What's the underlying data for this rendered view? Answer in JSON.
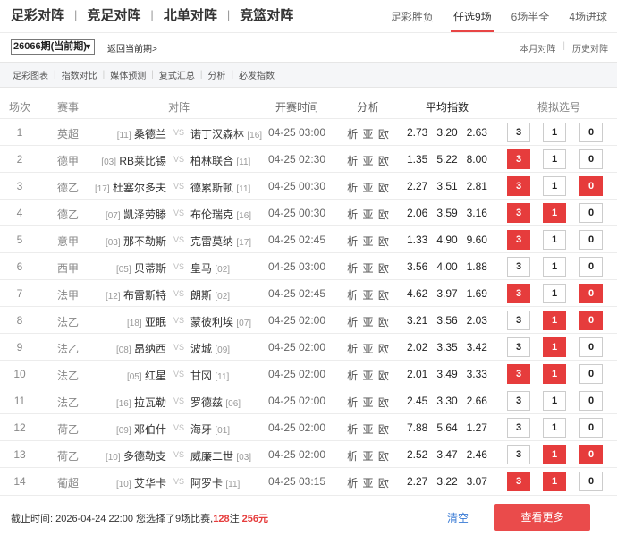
{
  "nav": {
    "items": [
      "足彩对阵",
      "竞足对阵",
      "北单对阵",
      "竞篮对阵"
    ],
    "separator": "|"
  },
  "tabs": [
    {
      "label": "足彩胜负",
      "active": false
    },
    {
      "label": "任选9场",
      "active": true
    },
    {
      "label": "6场半全",
      "active": false
    },
    {
      "label": "4场进球",
      "active": false
    }
  ],
  "issue": {
    "selected": "26066期(当前期)",
    "back_link": "返回当前期>",
    "right_links": [
      "本月对阵",
      "历史对阵"
    ]
  },
  "tools": [
    "足彩图表",
    "指数对比",
    "媒体预测",
    "复式汇总",
    "分析",
    "必发指数"
  ],
  "table": {
    "headers": {
      "no": "场次",
      "league": "赛事",
      "match": "对阵",
      "time": "开赛时间",
      "analysis": "分析",
      "odds": "平均指数",
      "options": "模拟选号"
    },
    "vs_label": "VS",
    "analysis_label": "析 亚 欧",
    "rows": [
      {
        "no": "1",
        "league": "英超",
        "home_rank": "[11]",
        "home": "桑德兰",
        "away": "诺丁汉森林",
        "away_rank": "[16]",
        "time": "04-25 03:00",
        "odds": [
          "2.73",
          "3.20",
          "2.63"
        ],
        "opt": [
          "3",
          "1",
          "0"
        ],
        "sel": [
          false,
          false,
          false
        ]
      },
      {
        "no": "2",
        "league": "德甲",
        "home_rank": "[03]",
        "home": "RB莱比锡",
        "away": "柏林联合",
        "away_rank": "[11]",
        "time": "04-25 02:30",
        "odds": [
          "1.35",
          "5.22",
          "8.00"
        ],
        "opt": [
          "3",
          "1",
          "0"
        ],
        "sel": [
          true,
          false,
          false
        ]
      },
      {
        "no": "3",
        "league": "德乙",
        "home_rank": "[17]",
        "home": "杜塞尔多夫",
        "away": "德累斯顿",
        "away_rank": "[11]",
        "time": "04-25 00:30",
        "odds": [
          "2.27",
          "3.51",
          "2.81"
        ],
        "opt": [
          "3",
          "1",
          "0"
        ],
        "sel": [
          true,
          false,
          true
        ]
      },
      {
        "no": "4",
        "league": "德乙",
        "home_rank": "[07]",
        "home": "凯泽劳滕",
        "away": "布伦瑞克",
        "away_rank": "[16]",
        "time": "04-25 00:30",
        "odds": [
          "2.06",
          "3.59",
          "3.16"
        ],
        "opt": [
          "3",
          "1",
          "0"
        ],
        "sel": [
          true,
          true,
          false
        ]
      },
      {
        "no": "5",
        "league": "意甲",
        "home_rank": "[03]",
        "home": "那不勒斯",
        "away": "克雷莫纳",
        "away_rank": "[17]",
        "time": "04-25 02:45",
        "odds": [
          "1.33",
          "4.90",
          "9.60"
        ],
        "opt": [
          "3",
          "1",
          "0"
        ],
        "sel": [
          true,
          false,
          false
        ]
      },
      {
        "no": "6",
        "league": "西甲",
        "home_rank": "[05]",
        "home": "贝蒂斯",
        "away": "皇马",
        "away_rank": "[02]",
        "time": "04-25 03:00",
        "odds": [
          "3.56",
          "4.00",
          "1.88"
        ],
        "opt": [
          "3",
          "1",
          "0"
        ],
        "sel": [
          false,
          false,
          false
        ]
      },
      {
        "no": "7",
        "league": "法甲",
        "home_rank": "[12]",
        "home": "布雷斯特",
        "away": "朗斯",
        "away_rank": "[02]",
        "time": "04-25 02:45",
        "odds": [
          "4.62",
          "3.97",
          "1.69"
        ],
        "opt": [
          "3",
          "1",
          "0"
        ],
        "sel": [
          true,
          false,
          true
        ]
      },
      {
        "no": "8",
        "league": "法乙",
        "home_rank": "[18]",
        "home": "亚眠",
        "away": "蒙彼利埃",
        "away_rank": "[07]",
        "time": "04-25 02:00",
        "odds": [
          "3.21",
          "3.56",
          "2.03"
        ],
        "opt": [
          "3",
          "1",
          "0"
        ],
        "sel": [
          false,
          true,
          true
        ]
      },
      {
        "no": "9",
        "league": "法乙",
        "home_rank": "[08]",
        "home": "昂纳西",
        "away": "波城",
        "away_rank": "[09]",
        "time": "04-25 02:00",
        "odds": [
          "2.02",
          "3.35",
          "3.42"
        ],
        "opt": [
          "3",
          "1",
          "0"
        ],
        "sel": [
          false,
          true,
          false
        ]
      },
      {
        "no": "10",
        "league": "法乙",
        "home_rank": "[05]",
        "home": "红星",
        "away": "甘冈",
        "away_rank": "[11]",
        "time": "04-25 02:00",
        "odds": [
          "2.01",
          "3.49",
          "3.33"
        ],
        "opt": [
          "3",
          "1",
          "0"
        ],
        "sel": [
          true,
          true,
          false
        ]
      },
      {
        "no": "11",
        "league": "法乙",
        "home_rank": "[16]",
        "home": "拉瓦勒",
        "away": "罗德兹",
        "away_rank": "[06]",
        "time": "04-25 02:00",
        "odds": [
          "2.45",
          "3.30",
          "2.66"
        ],
        "opt": [
          "3",
          "1",
          "0"
        ],
        "sel": [
          false,
          false,
          false
        ]
      },
      {
        "no": "12",
        "league": "荷乙",
        "home_rank": "[09]",
        "home": "邓伯什",
        "away": "海牙",
        "away_rank": "[01]",
        "time": "04-25 02:00",
        "odds": [
          "7.88",
          "5.64",
          "1.27"
        ],
        "opt": [
          "3",
          "1",
          "0"
        ],
        "sel": [
          false,
          false,
          false
        ]
      },
      {
        "no": "13",
        "league": "荷乙",
        "home_rank": "[10]",
        "home": "多德勒支",
        "away": "威廉二世",
        "away_rank": "[03]",
        "time": "04-25 02:00",
        "odds": [
          "2.52",
          "3.47",
          "2.46"
        ],
        "opt": [
          "3",
          "1",
          "0"
        ],
        "sel": [
          false,
          true,
          true
        ]
      },
      {
        "no": "14",
        "league": "葡超",
        "home_rank": "[10]",
        "home": "艾华卡",
        "away": "阿罗卡",
        "away_rank": "[11]",
        "time": "04-25 03:15",
        "odds": [
          "2.27",
          "3.22",
          "3.07"
        ],
        "opt": [
          "3",
          "1",
          "0"
        ],
        "sel": [
          true,
          true,
          false
        ]
      }
    ]
  },
  "footer": {
    "deadline_label": "截止时间:",
    "deadline": "2026-04-24 22:00",
    "selected_text": "您选择了9场比赛,",
    "bets": "128",
    "bets_unit": "注",
    "amount": "256元",
    "clear": "清空",
    "more": "查看更多"
  },
  "colors": {
    "accent": "#e63c3c",
    "link": "#3a7bd5"
  }
}
